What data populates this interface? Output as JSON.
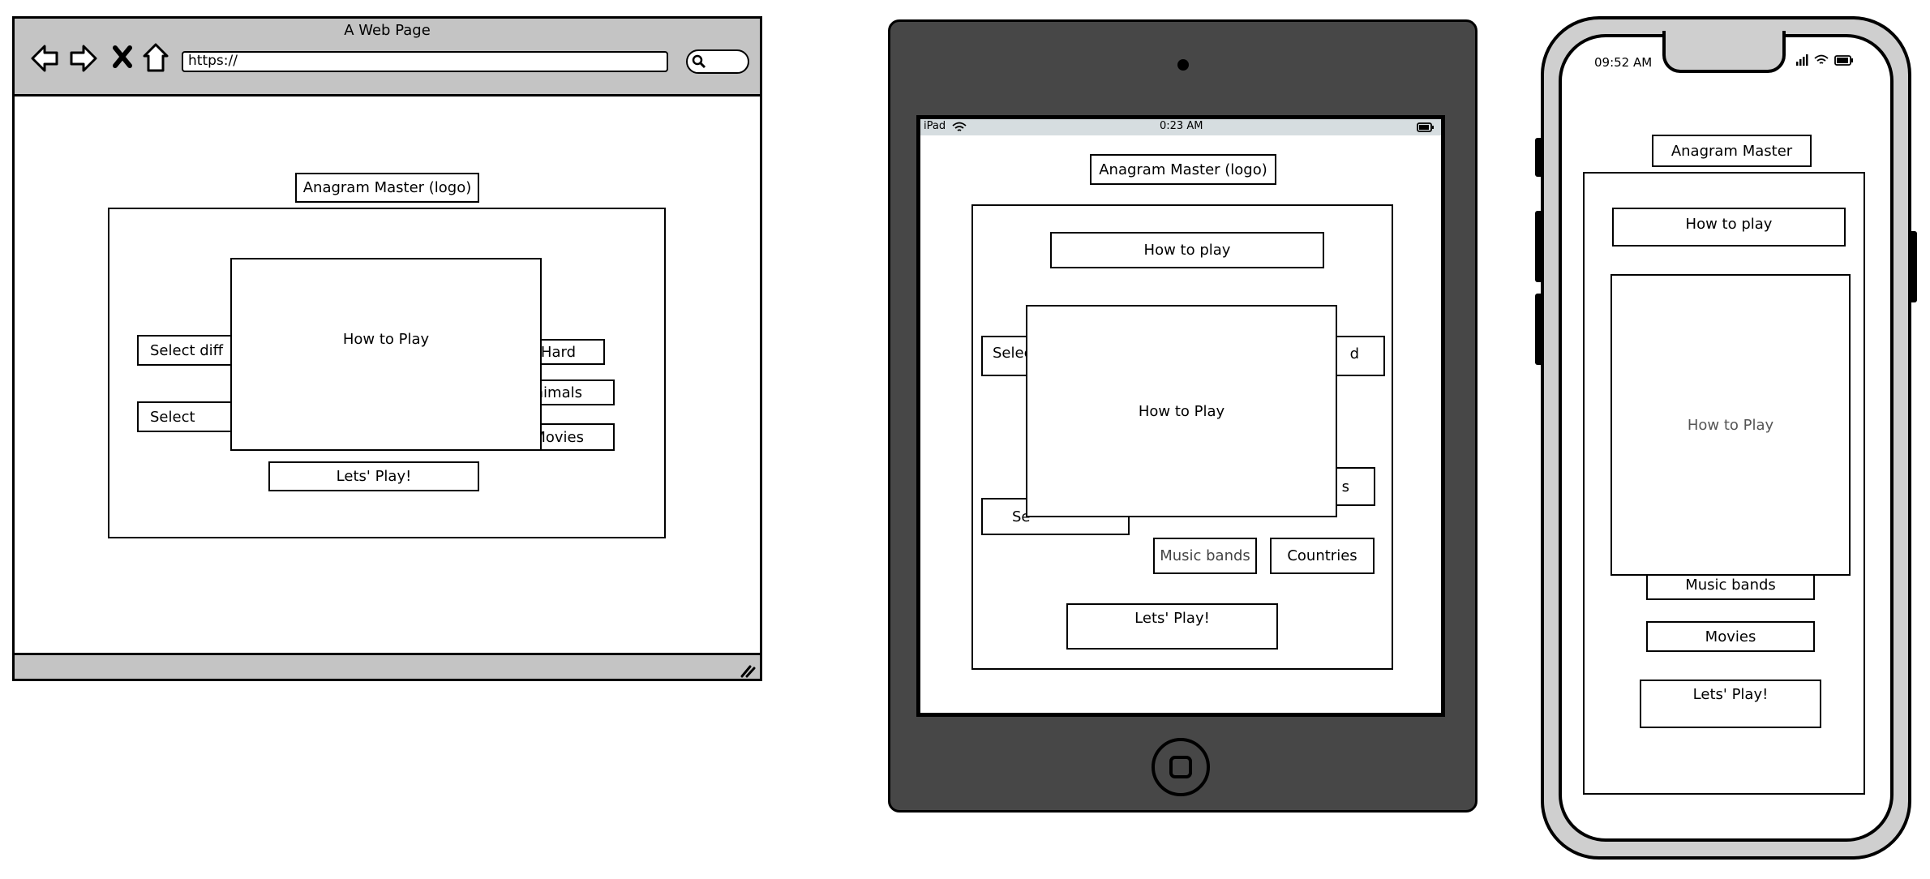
{
  "browser": {
    "title": "A Web Page",
    "url": "https://",
    "logo": "Anagram Master (logo)",
    "select_difficulty": "Select diff",
    "select_category": "Select",
    "hard": "Hard",
    "animals": "nimals",
    "movies": "Movies",
    "modal_title": "How to Play",
    "play": "Lets' Play!"
  },
  "ipad": {
    "status_device": "iPad",
    "status_time": "0:23 AM",
    "logo": "Anagram Master (logo)",
    "how_to_play_btn": "How to play",
    "select_partial_1": "Selec",
    "select_partial_2": "Se",
    "hard_partial": "d",
    "cat_partial": "s",
    "modal_title": "How to Play",
    "music_bands": "Music bands",
    "countries": "Countries",
    "play": "Lets' Play!"
  },
  "iphone": {
    "status_time": "09:52 AM",
    "logo": "Anagram Master",
    "how_to_play_btn": "How to play",
    "modal_title": "How to Play",
    "music_bands": "Music bands",
    "movies": "Movies",
    "play": "Lets' Play!"
  },
  "icons": [
    "back-arrow-icon",
    "forward-arrow-icon",
    "close-icon",
    "home-icon",
    "search-icon",
    "resize-grip-icon",
    "wifi-icon",
    "battery-icon",
    "signal-icon",
    "camera-icon",
    "home-button-icon"
  ]
}
